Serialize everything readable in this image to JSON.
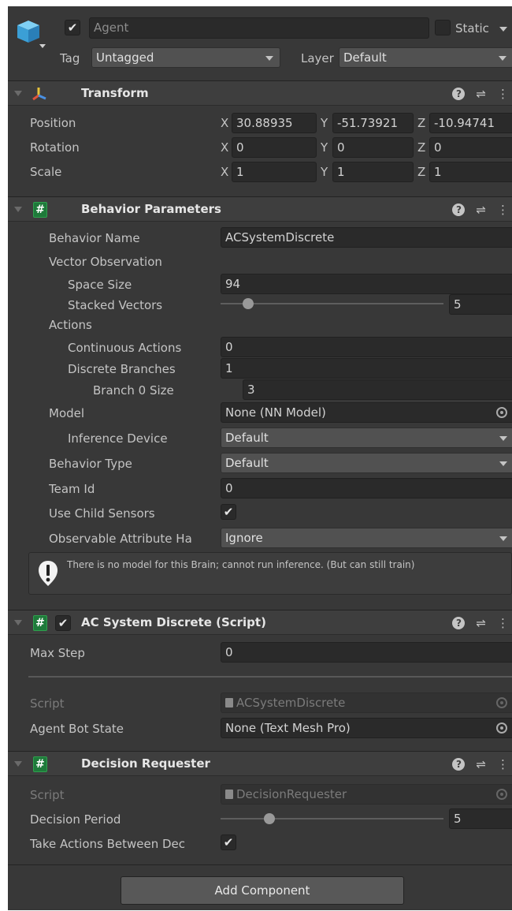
{
  "object": {
    "name": "Agent",
    "active": true,
    "static_label": "Static",
    "static_checked": false,
    "tag_label": "Tag",
    "tag_value": "Untagged",
    "layer_label": "Layer",
    "layer_value": "Default"
  },
  "transform": {
    "title": "Transform",
    "position_label": "Position",
    "rotation_label": "Rotation",
    "scale_label": "Scale",
    "axis_x": "X",
    "axis_y": "Y",
    "axis_z": "Z",
    "position": {
      "x": "30.88935",
      "y": "-51.73921",
      "z": "-10.94741"
    },
    "rotation": {
      "x": "0",
      "y": "0",
      "z": "0"
    },
    "scale": {
      "x": "1",
      "y": "1",
      "z": "1"
    }
  },
  "behavior_parameters": {
    "title": "Behavior Parameters",
    "behavior_name_label": "Behavior Name",
    "behavior_name": "ACSystemDiscrete",
    "vector_observation_label": "Vector Observation",
    "space_size_label": "Space Size",
    "space_size": "94",
    "stacked_vectors_label": "Stacked Vectors",
    "stacked_vectors": "5",
    "stacked_vectors_fraction": 0.125,
    "actions_label": "Actions",
    "continuous_actions_label": "Continuous Actions",
    "continuous_actions": "0",
    "discrete_branches_label": "Discrete Branches",
    "discrete_branches": "1",
    "branch0_size_label": "Branch 0 Size",
    "branch0_size": "3",
    "model_label": "Model",
    "model": "None (NN Model)",
    "inference_device_label": "Inference Device",
    "inference_device": "Default",
    "behavior_type_label": "Behavior Type",
    "behavior_type": "Default",
    "team_id_label": "Team Id",
    "team_id": "0",
    "use_child_sensors_label": "Use Child Sensors",
    "use_child_sensors": true,
    "observable_attr_label": "Observable Attribute Ha",
    "observable_attr": "Ignore",
    "warning": "There is no model for this Brain; cannot run inference. (But can still train)"
  },
  "ac_system": {
    "title": "AC System Discrete (Script)",
    "enabled": true,
    "max_step_label": "Max Step",
    "max_step": "0",
    "script_label": "Script",
    "script": "ACSystemDiscrete",
    "agent_bot_state_label": "Agent Bot State",
    "agent_bot_state": "None (Text Mesh Pro)"
  },
  "decision_requester": {
    "title": "Decision Requester",
    "script_label": "Script",
    "script": "DecisionRequester",
    "decision_period_label": "Decision Period",
    "decision_period": "5",
    "decision_period_fraction": 0.22,
    "take_actions_label": "Take Actions Between Dec",
    "take_actions": true
  },
  "add_component_label": "Add Component",
  "colors": {
    "background": "#383838",
    "header": "#3e3e3e",
    "field": "#2a2a2a",
    "transform_icon_red": "#e0533b",
    "transform_icon_yellow": "#e8c33a",
    "script_icon": "#1e7a3a",
    "cube_icon": "#4fb3e8"
  },
  "icons": {
    "game_object": "cube-icon",
    "transform": "transform-axes-icon",
    "script": "script-hash-icon",
    "help": "help-icon",
    "presets": "sliders-icon",
    "menu": "kebab-menu-icon",
    "warning": "warning-icon",
    "object_picker": "object-picker-icon"
  }
}
